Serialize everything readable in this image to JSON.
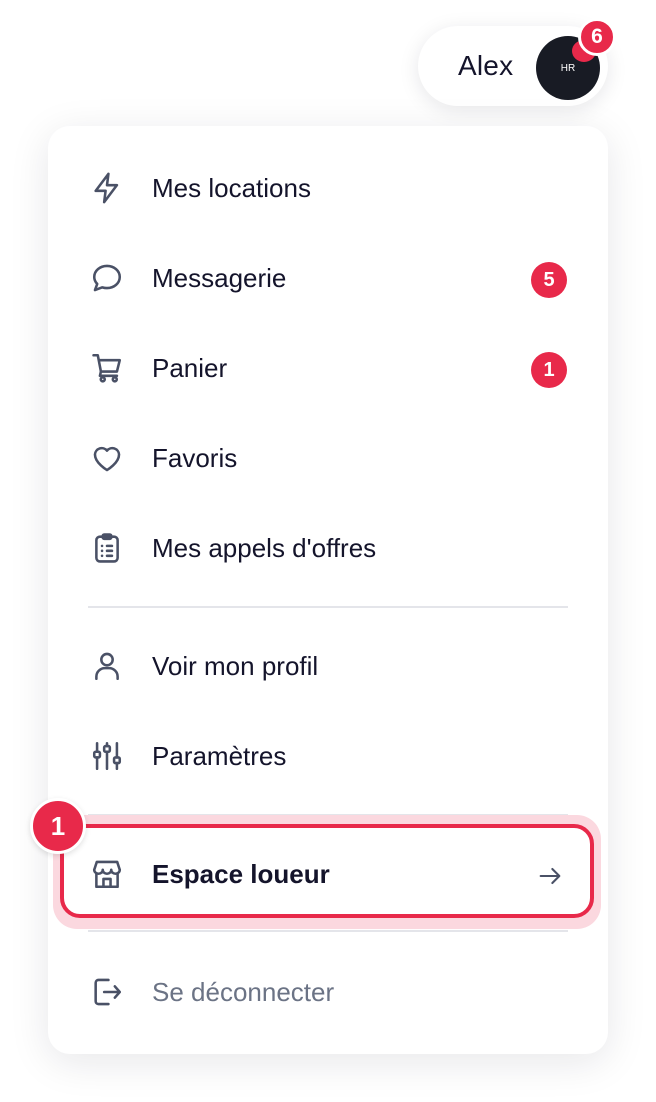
{
  "header": {
    "user_name": "Alex",
    "avatar_initials": "HR",
    "notification_count": "6"
  },
  "menu": {
    "items": [
      {
        "label": "Mes locations",
        "icon": "lightning-icon"
      },
      {
        "label": "Messagerie",
        "icon": "chat-bubble-icon",
        "badge": "5"
      },
      {
        "label": "Panier",
        "icon": "cart-icon",
        "badge": "1"
      },
      {
        "label": "Favoris",
        "icon": "heart-icon"
      },
      {
        "label": "Mes appels d'offres",
        "icon": "clipboard-list-icon"
      }
    ],
    "account_items": [
      {
        "label": "Voir mon profil",
        "icon": "user-icon"
      },
      {
        "label": "Paramètres",
        "icon": "sliders-icon"
      }
    ],
    "highlighted_item": {
      "label": "Espace loueur",
      "icon": "storefront-icon",
      "step": "1"
    },
    "logout": {
      "label": "Se déconnecter",
      "icon": "logout-icon"
    }
  },
  "colors": {
    "accent": "#e8294a",
    "text": "#14142b",
    "muted_text": "#6b7385",
    "icon": "#4a5166",
    "avatar_bg": "#181b24"
  }
}
